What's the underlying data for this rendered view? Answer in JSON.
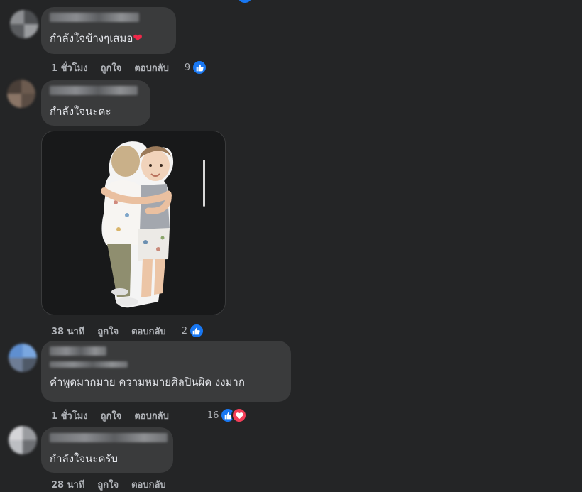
{
  "comments": [
    {
      "text": "กำลังใจข้างๆเสมอ",
      "has_heart_emoji": true,
      "time": "1 ชั่วโมง",
      "like_label": "ถูกใจ",
      "reply_label": "ตอบกลับ",
      "reaction_count": "9",
      "reactions": [
        "like-icon"
      ]
    },
    {
      "text": "กำลังใจนะคะ",
      "time": "38 นาที",
      "like_label": "ถูกใจ",
      "reply_label": "ตอบกลับ",
      "reaction_count": "2",
      "reactions": [
        "like-icon"
      ],
      "sticker": "two-children-hugging-sticker"
    },
    {
      "text": "คำพูดมากมาย ความหมายศิลปินผิด งงมาก",
      "time": "1 ชั่วโมง",
      "like_label": "ถูกใจ",
      "reply_label": "ตอบกลับ",
      "reaction_count": "16",
      "reactions": [
        "like-icon",
        "love-icon"
      ]
    },
    {
      "text": "กำลังใจนะครับ",
      "time": "28 นาที",
      "like_label": "ถูกใจ",
      "reply_label": "ตอบกลับ",
      "reactions": []
    }
  ],
  "colors": {
    "background": "#242526",
    "bubble": "#3a3b3c",
    "text": "#e4e6eb",
    "secondary_text": "#b0b3b8",
    "like_blue": "#1877f2",
    "love_red": "#f33e58"
  }
}
